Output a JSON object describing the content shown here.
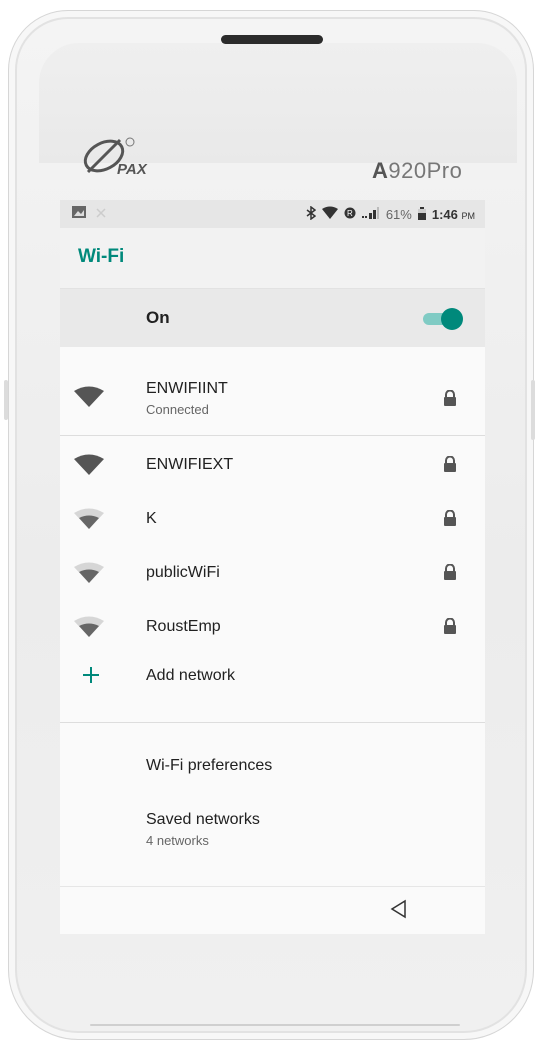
{
  "device": {
    "brand": "PAX",
    "model_prefix": "A",
    "model_suffix": "920Pro"
  },
  "status_bar": {
    "battery": "61%",
    "time": "1:46",
    "ampm": "PM"
  },
  "app": {
    "title": "Wi-Fi",
    "accent_color": "#00897b"
  },
  "wifi_toggle": {
    "label": "On",
    "state": "on"
  },
  "connected_network": {
    "name": "ENWIFIINT",
    "status": "Connected",
    "secured": true
  },
  "networks": [
    {
      "name": "ENWIFIEXT",
      "secured": true,
      "signal": "strong"
    },
    {
      "name": "K",
      "secured": true,
      "signal": "medium"
    },
    {
      "name": "publicWiFi",
      "secured": true,
      "signal": "medium"
    },
    {
      "name": "RoustEmp",
      "secured": true,
      "signal": "medium"
    }
  ],
  "add_network": {
    "label": "Add network",
    "icon": "plus-icon"
  },
  "preferences": {
    "label": "Wi-Fi preferences"
  },
  "saved_networks": {
    "label": "Saved networks",
    "sub": "4 networks"
  },
  "nav": {
    "back_icon": "back-triangle-icon"
  }
}
